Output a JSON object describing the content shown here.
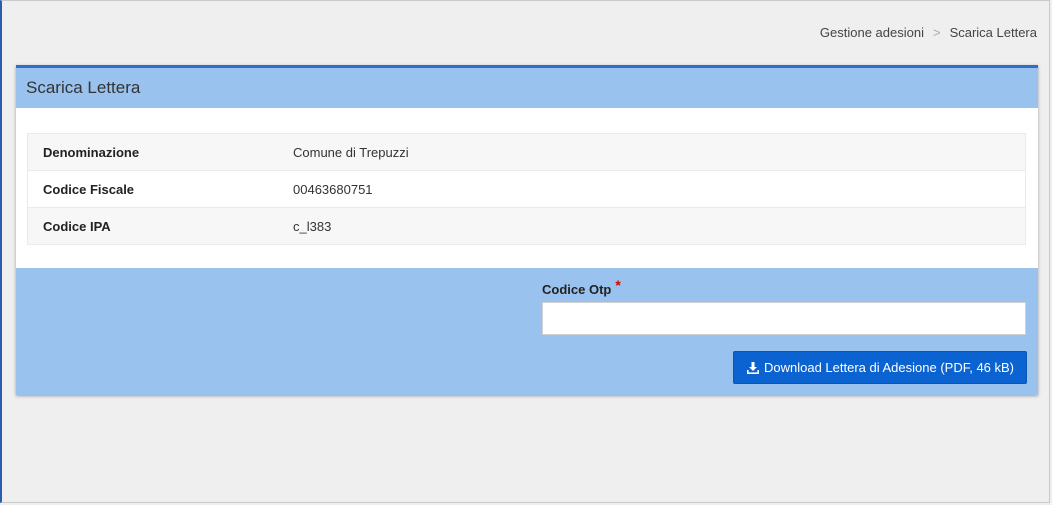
{
  "breadcrumb": {
    "items": [
      "Gestione adesioni",
      "Scarica Lettera"
    ],
    "separator": ">"
  },
  "panel": {
    "title": "Scarica Lettera",
    "rows": [
      {
        "label": "Denominazione",
        "value": "Comune di Trepuzzi"
      },
      {
        "label": "Codice Fiscale",
        "value": "00463680751"
      },
      {
        "label": "Codice IPA",
        "value": "c_l383"
      }
    ]
  },
  "form": {
    "otp_label": "Codice Otp",
    "required_mark": "*",
    "otp_value": "",
    "download_label": "Download Lettera di Adesione (PDF, 46 kB)",
    "download_icon": "download-icon"
  },
  "colors": {
    "accent": "#2f70c6",
    "panel_bg": "#99c2ee",
    "button_bg": "#0b63d1",
    "required": "#dd0000"
  }
}
